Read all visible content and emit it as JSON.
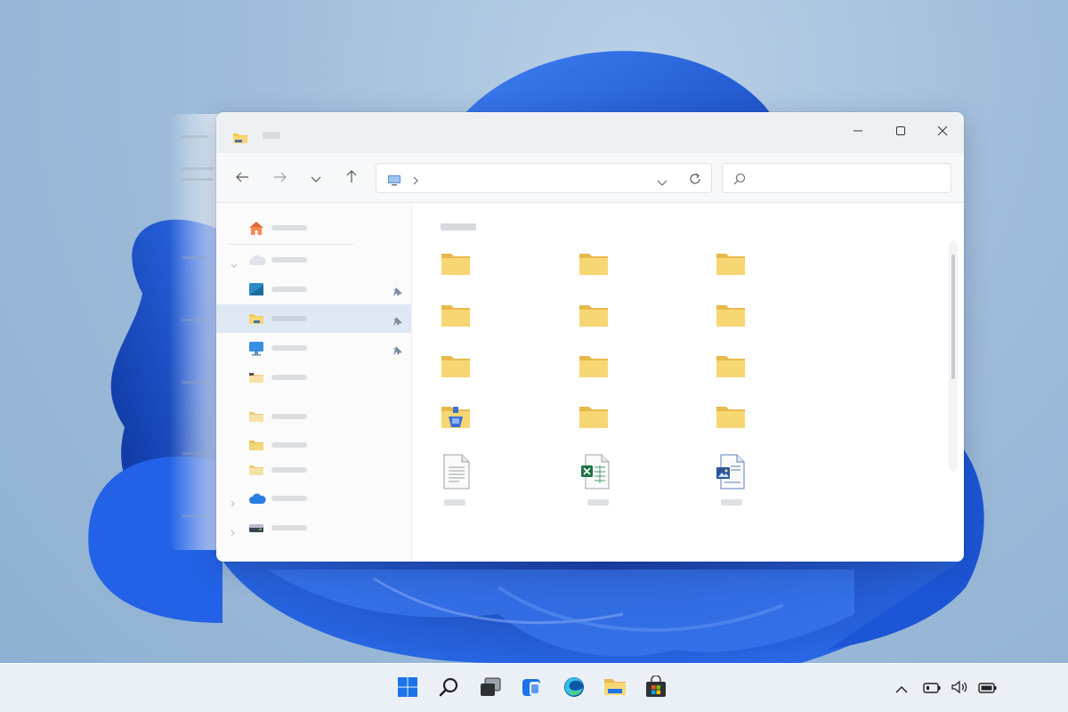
{
  "window": {
    "title": "",
    "controls": {
      "minimize_icon": "minimize-icon",
      "maximize_icon": "maximize-icon",
      "close_icon": "close-icon"
    }
  },
  "toolbar": {
    "back_icon": "arrow-left-icon",
    "forward_icon": "arrow-right-icon",
    "recent_icon": "chevron-down-icon",
    "up_icon": "arrow-up-icon",
    "address": {
      "path": "",
      "refresh_icon": "refresh-icon"
    },
    "search": {
      "placeholder": "",
      "value": ""
    }
  },
  "sidebar": {
    "items": [
      {
        "icon": "home-icon",
        "label": "",
        "pinned": false,
        "selected": false
      },
      {
        "icon": "cloud-icon",
        "label": "",
        "pinned": false,
        "selected": false,
        "expandable": true
      },
      {
        "icon": "desktop-icon",
        "label": "",
        "pinned": true,
        "selected": false
      },
      {
        "icon": "downloads-folder-icon",
        "label": "",
        "pinned": true,
        "selected": true
      },
      {
        "icon": "monitor-icon",
        "label": "",
        "pinned": true,
        "selected": false
      },
      {
        "icon": "folder-icon",
        "label": "",
        "pinned": false,
        "selected": false
      },
      {
        "icon": "folder-icon",
        "label": "",
        "pinned": false,
        "selected": false
      },
      {
        "icon": "folder-icon",
        "label": "",
        "pinned": false,
        "selected": false
      },
      {
        "icon": "folder-icon",
        "label": "",
        "pinned": false,
        "selected": false
      },
      {
        "icon": "onedrive-icon",
        "label": "",
        "pinned": false,
        "selected": false,
        "expandable": true
      },
      {
        "icon": "drive-icon",
        "label": "",
        "pinned": false,
        "selected": false,
        "expandable": true
      }
    ]
  },
  "content": {
    "section": "",
    "items": [
      {
        "icon": "folder-icon",
        "name": ""
      },
      {
        "icon": "folder-icon",
        "name": ""
      },
      {
        "icon": "folder-icon",
        "name": ""
      },
      {
        "icon": "folder-icon",
        "name": ""
      },
      {
        "icon": "folder-icon",
        "name": ""
      },
      {
        "icon": "folder-icon",
        "name": ""
      },
      {
        "icon": "folder-icon",
        "name": ""
      },
      {
        "icon": "folder-icon",
        "name": ""
      },
      {
        "icon": "folder-icon",
        "name": ""
      },
      {
        "icon": "special-folder-icon",
        "name": ""
      },
      {
        "icon": "folder-icon",
        "name": ""
      },
      {
        "icon": "folder-icon",
        "name": ""
      },
      {
        "icon": "text-file-icon",
        "name": ""
      },
      {
        "icon": "excel-file-icon",
        "name": ""
      },
      {
        "icon": "image-file-icon",
        "name": ""
      }
    ]
  },
  "taskbar": {
    "apps": [
      "windows-start-icon",
      "search-icon",
      "task-view-icon",
      "widgets-icon",
      "edge-icon",
      "file-explorer-icon",
      "store-icon"
    ],
    "tray": [
      "chevron-up-icon",
      "battery-saver-icon",
      "volume-icon",
      "battery-icon"
    ]
  },
  "colors": {
    "folder": "#f2c94c",
    "selection": "#dfe9f6",
    "accent": "#0a5cc9",
    "wallpaper_bloom": "#1f5fe0"
  }
}
